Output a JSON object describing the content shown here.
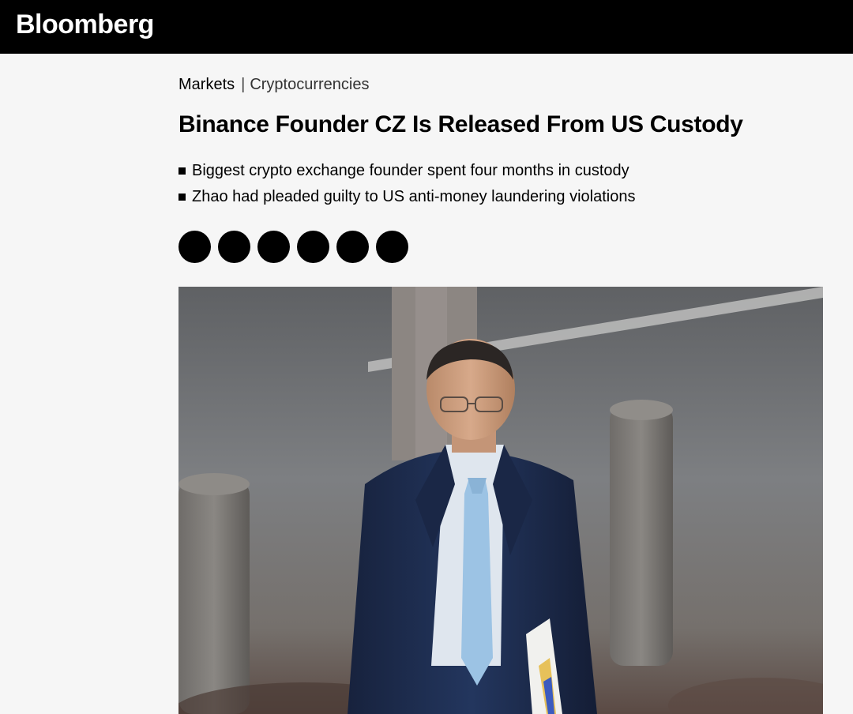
{
  "header": {
    "logo": "Bloomberg"
  },
  "breadcrumb": {
    "section": "Markets",
    "separator": "|",
    "subsection": "Cryptocurrencies"
  },
  "article": {
    "headline": "Binance Founder CZ Is Released From US Custody",
    "bullets": [
      "Biggest crypto exchange founder spent four months in custody",
      "Zhao had pleaded guilty to US anti-money laundering violations"
    ]
  },
  "share_buttons": [
    {
      "icon": "share-circle-icon"
    },
    {
      "icon": "share-circle-icon"
    },
    {
      "icon": "share-circle-icon"
    },
    {
      "icon": "share-circle-icon"
    },
    {
      "icon": "share-circle-icon"
    },
    {
      "icon": "share-circle-icon"
    }
  ],
  "hero_image": {
    "subject": "man in navy suit and light blue tie walking outdoors, carrying papers"
  },
  "colors": {
    "topbar": "#000000",
    "page_background": "#f6f6f6",
    "suit": "#1f2f52",
    "tie": "#9cc3e4"
  }
}
